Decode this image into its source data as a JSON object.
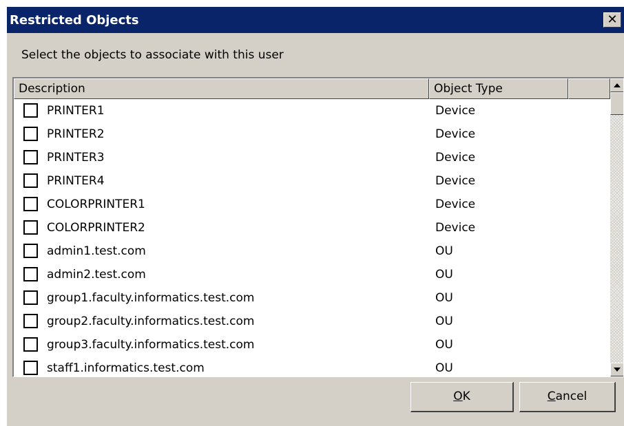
{
  "dialog": {
    "title": "Restricted Objects",
    "close_label": "✕",
    "instruction": "Select the objects to associate with this user"
  },
  "list": {
    "columns": [
      "Description",
      "Object Type",
      ""
    ],
    "rows": [
      {
        "description": "PRINTER1",
        "type": "Device",
        "checked": false
      },
      {
        "description": "PRINTER2",
        "type": "Device",
        "checked": false
      },
      {
        "description": "PRINTER3",
        "type": "Device",
        "checked": false
      },
      {
        "description": "PRINTER4",
        "type": "Device",
        "checked": false
      },
      {
        "description": "COLORPRINTER1",
        "type": "Device",
        "checked": false
      },
      {
        "description": "COLORPRINTER2",
        "type": "Device",
        "checked": false
      },
      {
        "description": "admin1.test.com",
        "type": "OU",
        "checked": false
      },
      {
        "description": "admin2.test.com",
        "type": "OU",
        "checked": false
      },
      {
        "description": "group1.faculty.informatics.test.com",
        "type": "OU",
        "checked": false
      },
      {
        "description": "group2.faculty.informatics.test.com",
        "type": "OU",
        "checked": false
      },
      {
        "description": "group3.faculty.informatics.test.com",
        "type": "OU",
        "checked": false
      },
      {
        "description": "staff1.informatics.test.com",
        "type": "OU",
        "checked": false
      }
    ]
  },
  "buttons": {
    "ok": {
      "accel": "O",
      "rest": "K"
    },
    "cancel": {
      "accel": "C",
      "rest": "ancel"
    }
  },
  "colors": {
    "titlebar": "#0a246a",
    "face": "#d4d0c8",
    "window": "#ffffff"
  }
}
